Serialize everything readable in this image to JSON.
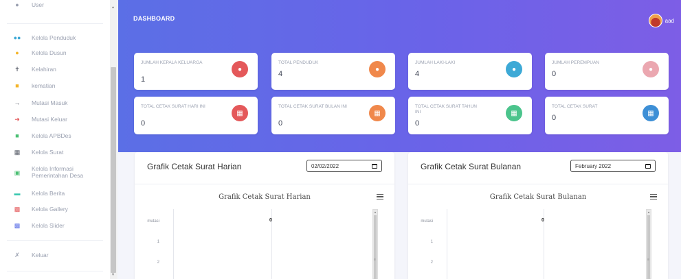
{
  "sidebar": {
    "items": [
      {
        "label": "User",
        "icon": "user-icon",
        "color": "#9aa0b0"
      },
      {
        "label": "Kelola Penduduk",
        "icon": "users-icon",
        "color": "#3da9d6"
      },
      {
        "label": "Kelola Dusun",
        "icon": "map-pin-icon",
        "color": "#f4b52a"
      },
      {
        "label": "Kelahiran",
        "icon": "baby-icon",
        "color": "#555a66"
      },
      {
        "label": "kematian",
        "icon": "truck-icon",
        "color": "#f4b52a"
      },
      {
        "label": "Mutasi Masuk",
        "icon": "sign-in-icon",
        "color": "#555a66"
      },
      {
        "label": "Mutasi Keluar",
        "icon": "sign-out-icon",
        "color": "#e4585a"
      },
      {
        "label": "Kelola APBDes",
        "icon": "money-icon",
        "color": "#4bbf73"
      },
      {
        "label": "Kelola Surat",
        "icon": "file-icon",
        "color": "#555a66"
      },
      {
        "label": "Kelola Informasi Pemerintahan Desa",
        "icon": "info-icon",
        "color": "#4bbf73"
      },
      {
        "label": "Kelola Berita",
        "icon": "news-icon",
        "color": "#3dc8b0"
      },
      {
        "label": "Kelola Gallery",
        "icon": "gallery-icon",
        "color": "#e4585a"
      },
      {
        "label": "Kelola Slider",
        "icon": "slider-icon",
        "color": "#5b6fe6"
      },
      {
        "label": "Keluar",
        "icon": "logout-icon",
        "color": "#9aa0b0"
      }
    ]
  },
  "header": {
    "title": "DASHBOARD",
    "user": "aad"
  },
  "stats": [
    {
      "label": "JUMLAH KEPALA KELUARGA",
      "value": "1",
      "icon": "user-icon",
      "color": "#e4585a"
    },
    {
      "label": "TOTAL PENDUDUK",
      "value": "4",
      "icon": "users-icon",
      "color": "#f0884b"
    },
    {
      "label": "JUMLAH LAKI-LAKI",
      "value": "4",
      "icon": "user-icon",
      "color": "#3da9d6"
    },
    {
      "label": "JUMLAH PEREMPUAN",
      "value": "0",
      "icon": "user-icon",
      "color": "#eba7b0"
    },
    {
      "label": "TOTAL CETAK SURAT HARI INI",
      "value": "0",
      "icon": "file-icon",
      "color": "#e4585a"
    },
    {
      "label": "TOTAL CETAK SURAT BULAN INI",
      "value": "0",
      "icon": "file-icon",
      "color": "#f0884b"
    },
    {
      "label": "TOTAL CETAK SURAT TAHUN INI",
      "value": "0",
      "icon": "file-icon",
      "color": "#4bc48c"
    },
    {
      "label": "TOTAL CETAK SURAT",
      "value": "0",
      "icon": "file-icon",
      "color": "#3d8fd6"
    }
  ],
  "panels": [
    {
      "title": "Grafik Cetak Surat Harian",
      "input_value": "02/02/2022",
      "chart_title": "Grafik Cetak Surat Harian",
      "y_labels": [
        "mutasi",
        "1",
        "2"
      ],
      "point_label": "0"
    },
    {
      "title": "Grafik Cetak Surat Bulanan",
      "input_value": "February 2022",
      "chart_title": "Grafik Cetak Surat Bulanan",
      "y_labels": [
        "mutasi",
        "1",
        "2"
      ],
      "point_label": "0"
    }
  ]
}
